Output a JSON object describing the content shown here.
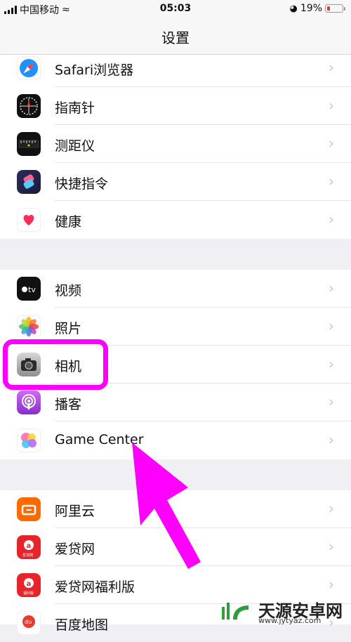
{
  "status_bar": {
    "carrier": "中国移动",
    "time": "05:03",
    "battery": "19%"
  },
  "nav": {
    "title": "设置"
  },
  "groups": [
    {
      "items": [
        {
          "label": "Safari浏览器",
          "icon": "safari-icon"
        },
        {
          "label": "指南针",
          "icon": "compass-icon"
        },
        {
          "label": "测距仪",
          "icon": "measure-icon"
        },
        {
          "label": "快捷指令",
          "icon": "shortcuts-icon"
        },
        {
          "label": "健康",
          "icon": "health-icon"
        }
      ]
    },
    {
      "items": [
        {
          "label": "视频",
          "icon": "apple-tv-icon"
        },
        {
          "label": "照片",
          "icon": "photos-icon"
        },
        {
          "label": "相机",
          "icon": "camera-icon"
        },
        {
          "label": "播客",
          "icon": "podcasts-icon"
        },
        {
          "label": "Game Center",
          "icon": "game-center-icon"
        }
      ]
    },
    {
      "items": [
        {
          "label": "阿里云",
          "icon": "aliyun-icon"
        },
        {
          "label": "爱贷网",
          "icon": "aidai-icon"
        },
        {
          "label": "爱贷网福利版",
          "icon": "aidai-fuli-icon"
        },
        {
          "label": "百度地图",
          "icon": "baidu-map-icon"
        }
      ]
    }
  ],
  "icon_labels": {
    "tv": "tv",
    "aidai": "爱贷网",
    "aidai_fuli": "福利版",
    "baidu": "du"
  },
  "watermark": {
    "title": "天源安卓网",
    "url": "www.jytyaz.com"
  },
  "colors": {
    "highlight": "#ff00ff",
    "separator": "#efeff4"
  }
}
